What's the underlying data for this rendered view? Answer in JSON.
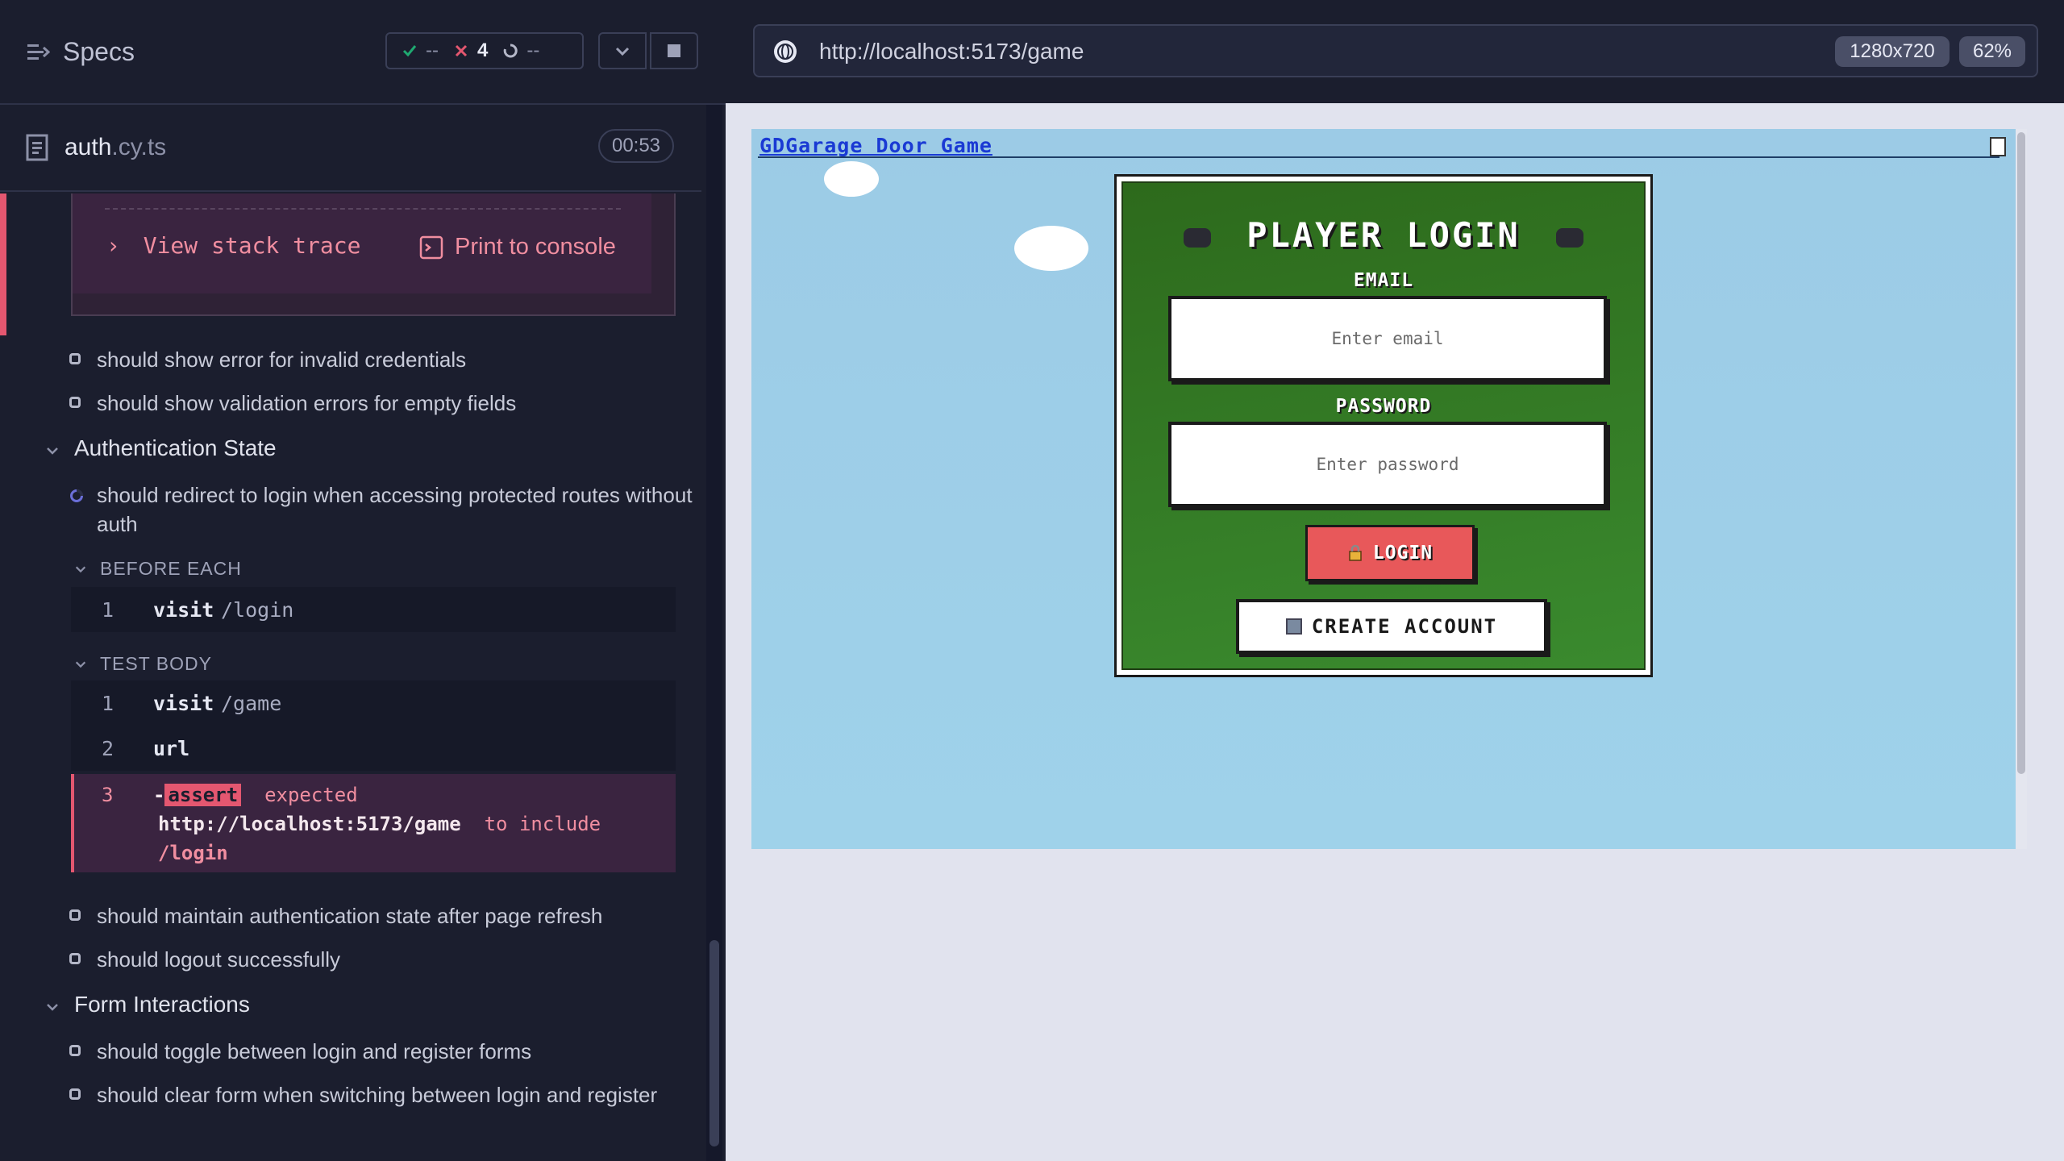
{
  "reporter": {
    "header_title": "Specs",
    "stats": {
      "passed": "--",
      "failed": "4",
      "pending": "--"
    },
    "spec_file": {
      "name": "auth",
      "ext": ".cy.ts",
      "duration": "00:53"
    },
    "error": {
      "stack_trace_label": "View stack trace",
      "print_label": "Print to console"
    },
    "tests_before": [
      "should show error for invalid credentials",
      "should show validation errors for empty fields"
    ],
    "suite_auth_state": "Authentication State",
    "running_test": "should redirect to login when accessing protected routes without auth",
    "before_each": {
      "label": "BEFORE EACH",
      "commands": [
        {
          "num": "1",
          "name": "visit",
          "arg": "/login"
        }
      ]
    },
    "test_body": {
      "label": "TEST BODY",
      "commands": [
        {
          "num": "1",
          "name": "visit",
          "arg": "/game"
        },
        {
          "num": "2",
          "name": "url",
          "arg": ""
        }
      ],
      "assert": {
        "num": "3",
        "prefix": "-",
        "badge": "assert",
        "expected_word": "expected",
        "actual": "http://localhost:5173/game",
        "to_include": "to include",
        "expected_value": "/login"
      }
    },
    "tests_after": [
      "should maintain authentication state after page refresh",
      "should logout successfully"
    ],
    "suite_form": "Form Interactions",
    "form_tests": [
      "should toggle between login and register forms",
      "should clear form when switching between login and register"
    ]
  },
  "preview": {
    "url": "http://localhost:5173/game",
    "viewport": "1280x720",
    "zoom": "62%",
    "game": {
      "title": "GDGarage Door Game",
      "login_title": "PLAYER LOGIN",
      "email_label": "EMAIL",
      "email_placeholder": "Enter email",
      "password_label": "PASSWORD",
      "password_placeholder": "Enter password",
      "login_button": "LOGIN",
      "create_button": "CREATE ACCOUNT"
    }
  },
  "colors": {
    "fail": "#e45770",
    "pass": "#1fa971",
    "link": "#1a3ad4",
    "login_button": "#e8585a",
    "card_green": "#3a8a2e"
  }
}
